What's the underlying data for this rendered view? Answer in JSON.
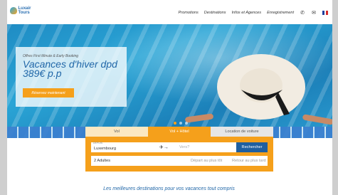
{
  "header": {
    "logo_text": "Luxair Tours",
    "nav": [
      "Promotions",
      "Destinations",
      "Infos et Agences",
      "Enregistrement"
    ],
    "icons": [
      "phone-icon",
      "mail-icon",
      "flag-icon"
    ]
  },
  "hero": {
    "kicker": "Offres First Minute & Early Booking",
    "title": "Vacances d'hiver dpd 389€ p.p",
    "cta": "Réservez maintenant"
  },
  "search": {
    "tabs": [
      "Vol",
      "Vol + Hôtel",
      "Location de voiture"
    ],
    "active_tab": "Vol + Hôtel",
    "from_label": "DEPUIS",
    "from_value": "Luxembourg",
    "to_placeholder": "Vers?",
    "search_button": "Rechercher",
    "passengers": "2 Adultes",
    "departure_placeholder": "Départ au plus tôt",
    "return_placeholder": "Retour au plus tard"
  },
  "section_title": "Les meilleures destinations pour vos vacances tout compris",
  "colors": {
    "accent": "#f5a01b",
    "brand": "#2167a8",
    "button": "#1f5fa0"
  }
}
